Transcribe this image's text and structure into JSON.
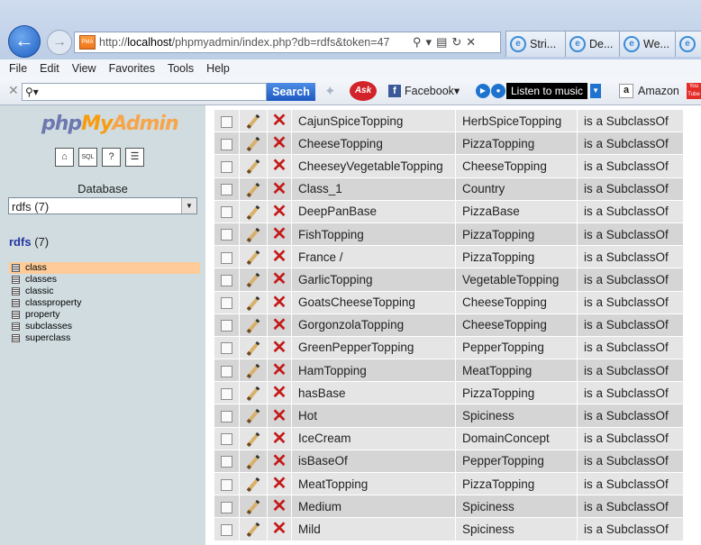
{
  "browser": {
    "url_prefix": "http://",
    "url_host": "localhost",
    "url_path": "/phpmyadmin/index.php?db=rdfs&token=47",
    "tabs": [
      "Stri...",
      "De...",
      "We..."
    ],
    "favicon_text": "PMA"
  },
  "menu": [
    "File",
    "Edit",
    "View",
    "Favorites",
    "Tools",
    "Help"
  ],
  "toolbar": {
    "search_label": "Search",
    "ask_label": "Ask",
    "facebook_label": "Facebook",
    "music_label": "Listen to music",
    "amazon_label": "Amazon"
  },
  "sidebar": {
    "logo_php": "php",
    "logo_my": "My",
    "logo_admin": "Admin",
    "database_label": "Database",
    "selected_db": "rdfs (7)",
    "db_name": "rdfs",
    "db_count": "(7)",
    "tables": [
      "class",
      "classes",
      "classic",
      "classproperty",
      "property",
      "subclasses",
      "superclass"
    ],
    "active_table": "class"
  },
  "results": [
    {
      "subject": "CajunSpiceTopping",
      "object": "HerbSpiceTopping",
      "relation": "is a SubclassOf"
    },
    {
      "subject": "CheeseTopping",
      "object": "PizzaTopping",
      "relation": "is a SubclassOf"
    },
    {
      "subject": "CheeseyVegetableTopping",
      "object": "CheeseTopping",
      "relation": "is a SubclassOf"
    },
    {
      "subject": "Class_1",
      "object": "Country",
      "relation": "is a SubclassOf"
    },
    {
      "subject": "DeepPanBase",
      "object": "PizzaBase",
      "relation": "is a SubclassOf"
    },
    {
      "subject": "FishTopping",
      "object": "PizzaTopping",
      "relation": "is a SubclassOf"
    },
    {
      "subject": "France /",
      "object": "PizzaTopping",
      "relation": "is a SubclassOf"
    },
    {
      "subject": "GarlicTopping",
      "object": "VegetableTopping",
      "relation": "is a SubclassOf"
    },
    {
      "subject": "GoatsCheeseTopping",
      "object": "CheeseTopping",
      "relation": "is a SubclassOf"
    },
    {
      "subject": "GorgonzolaTopping",
      "object": "CheeseTopping",
      "relation": "is a SubclassOf"
    },
    {
      "subject": "GreenPepperTopping",
      "object": "PepperTopping",
      "relation": "is a SubclassOf"
    },
    {
      "subject": "HamTopping",
      "object": "MeatTopping",
      "relation": "is a SubclassOf"
    },
    {
      "subject": "hasBase",
      "object": "PizzaTopping",
      "relation": "is a SubclassOf"
    },
    {
      "subject": "Hot",
      "object": "Spiciness",
      "relation": "is a SubclassOf"
    },
    {
      "subject": "IceCream",
      "object": "DomainConcept",
      "relation": "is a SubclassOf"
    },
    {
      "subject": "isBaseOf",
      "object": "PepperTopping",
      "relation": "is a SubclassOf"
    },
    {
      "subject": "MeatTopping",
      "object": "PizzaTopping",
      "relation": "is a SubclassOf"
    },
    {
      "subject": "Medium",
      "object": "Spiciness",
      "relation": "is a SubclassOf"
    },
    {
      "subject": "Mild",
      "object": "Spiciness",
      "relation": "is a SubclassOf"
    }
  ],
  "icons": {
    "edit": "pencil-icon",
    "delete": "delete-x-icon",
    "select": "row-checkbox",
    "colors": {
      "delete": "#c41a1a",
      "active_row": "#ffcc99",
      "left_bg": "#d0dce0"
    }
  }
}
